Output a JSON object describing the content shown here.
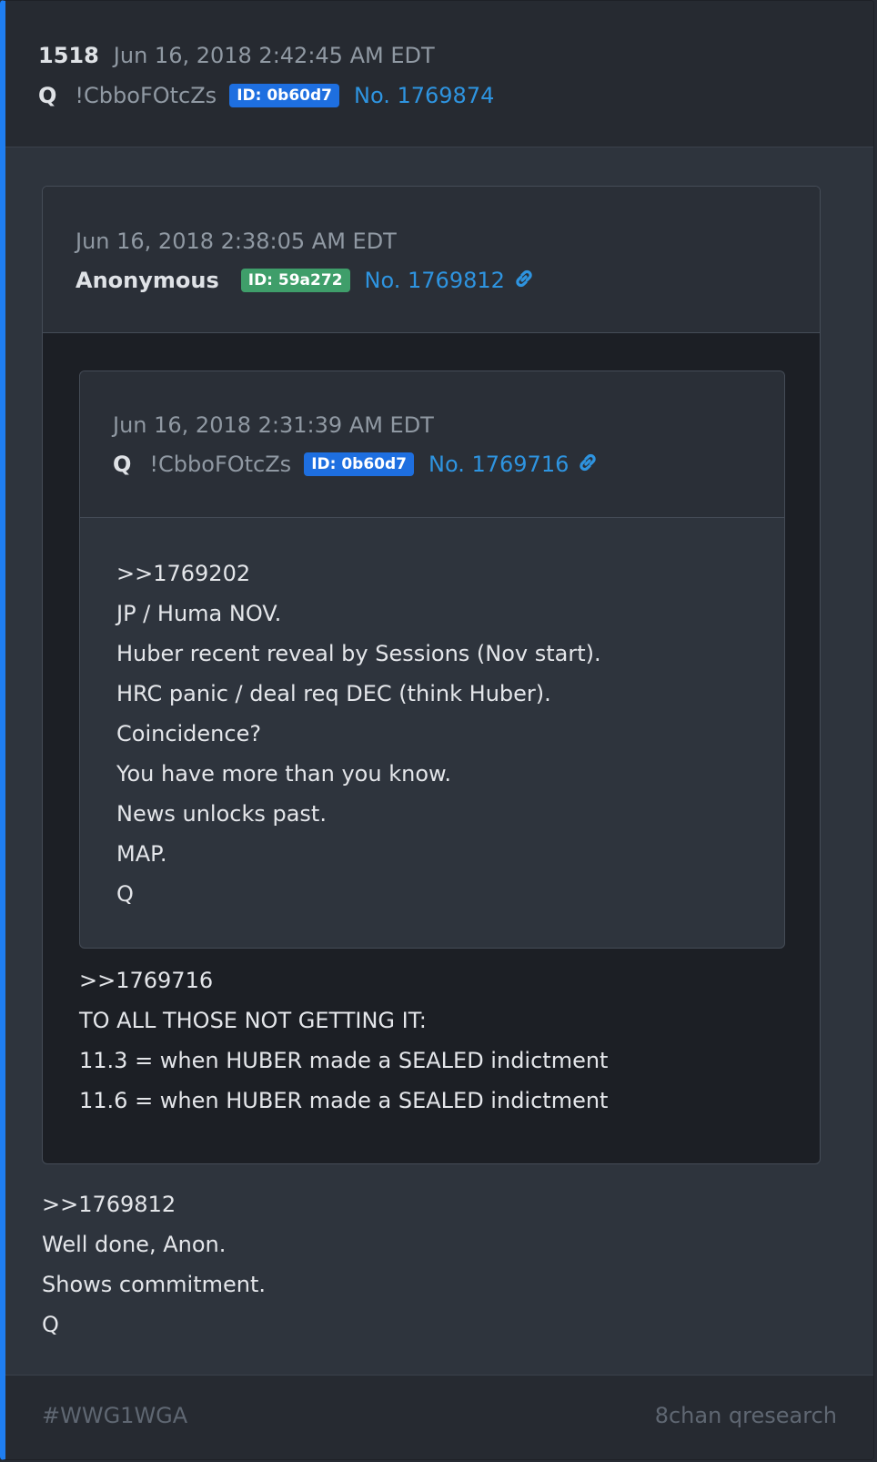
{
  "post": {
    "number": "1518",
    "timestamp": "Jun 16, 2018 2:42:45 AM EDT",
    "author": "Q",
    "tripcode": "!CbboFOtcZs",
    "id_badge": "ID: 0b60d7",
    "post_no": "No. 1769874",
    "body": [
      ">>1769812",
      "Well done, Anon.",
      "Shows commitment.",
      "Q"
    ]
  },
  "quote1": {
    "timestamp": "Jun 16, 2018 2:38:05 AM EDT",
    "author": "Anonymous",
    "id_badge": "ID: 59a272",
    "post_no": "No. 1769812",
    "body": [
      ">>1769716",
      "TO ALL THOSE NOT GETTING IT:",
      "11.3 = when HUBER made a SEALED indictment",
      "11.6 = when HUBER made a SEALED indictment"
    ]
  },
  "quote2": {
    "timestamp": "Jun 16, 2018 2:31:39 AM EDT",
    "author": "Q",
    "tripcode": "!CbboFOtcZs",
    "id_badge": "ID: 0b60d7",
    "post_no": "No. 1769716",
    "body": [
      ">>1769202",
      "JP / Huma NOV.",
      "Huber recent reveal by Sessions (Nov start).",
      "HRC panic / deal req DEC (think Huber).",
      "Coincidence?",
      "You have more than you know.",
      "News unlocks past.",
      "MAP.",
      "Q"
    ]
  },
  "footer": {
    "hashtag": "#WWG1WGA",
    "source": "8chan qresearch"
  },
  "colors": {
    "accent": "#1f7ef1",
    "link": "#2e94e0",
    "id_blue": "#1e6fe0",
    "id_green": "#3f9e6a"
  },
  "icons": {
    "link": "link-icon"
  }
}
